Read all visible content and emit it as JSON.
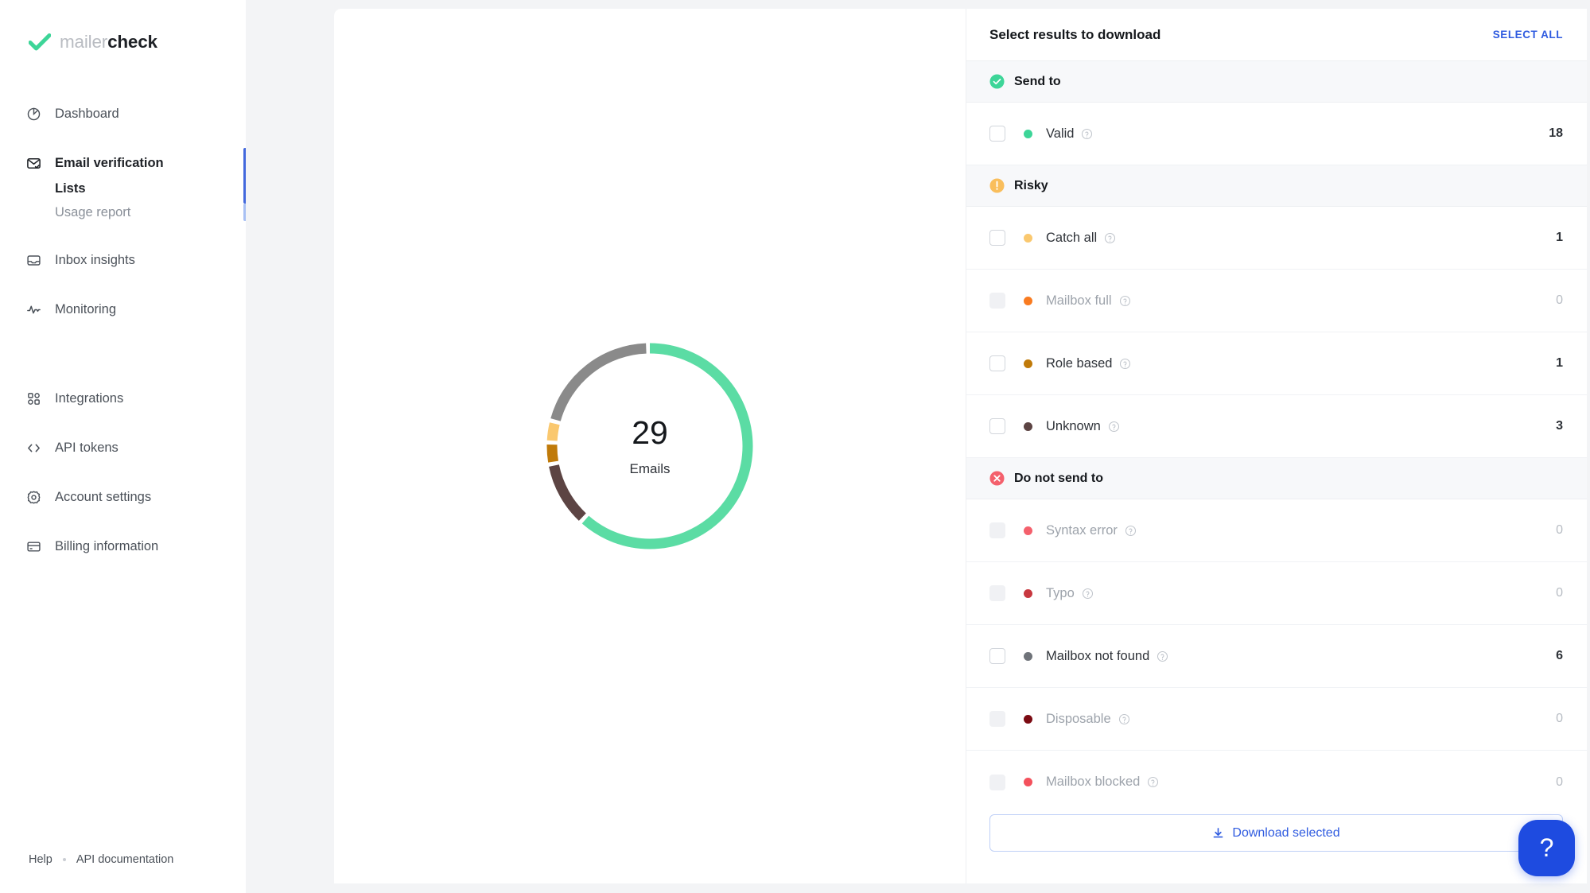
{
  "brand": {
    "name_light": "mailer",
    "name_bold": "check",
    "check_icon": "check-mark-icon",
    "green": "#3DD598"
  },
  "sidebar": {
    "items": [
      {
        "label": "Dashboard",
        "icon": "pie-chart-icon",
        "active": false
      },
      {
        "label": "Email verification",
        "icon": "envelope-check-icon",
        "active": true
      },
      {
        "label": "Inbox insights",
        "icon": "inbox-icon",
        "active": false
      },
      {
        "label": "Monitoring",
        "icon": "activity-pulse-icon",
        "active": false
      },
      {
        "label": "Integrations",
        "icon": "grid-squares-icon",
        "active": false
      },
      {
        "label": "API tokens",
        "icon": "code-brackets-icon",
        "active": false
      },
      {
        "label": "Account settings",
        "icon": "gear-icon",
        "active": false
      },
      {
        "label": "Billing information",
        "icon": "credit-card-icon",
        "active": false
      }
    ],
    "subnav": [
      {
        "label": "Lists",
        "active": true
      },
      {
        "label": "Usage report",
        "active": false
      }
    ],
    "footer": {
      "help": "Help",
      "api_documentation": "API documentation"
    },
    "active_accent": "#4268DD"
  },
  "chart_data": {
    "type": "pie",
    "title": "",
    "center_value": "29",
    "center_label": "Emails",
    "total": 29,
    "categories": [
      "Valid",
      "Unknown",
      "Role based",
      "Catch all",
      "Mailbox not found"
    ],
    "values": [
      18,
      3,
      1,
      1,
      6
    ],
    "colors": [
      "#5BDCA4",
      "#5C4443",
      "#C07A09",
      "#FAC86F",
      "#8A8A8A"
    ],
    "legend": "none",
    "donut": true
  },
  "results": {
    "title": "Select results to download",
    "select_all_label": "SELECT ALL",
    "groups": [
      {
        "name": "Send to",
        "badge_icon": "check-circle-icon",
        "badge_color": "#3DD598",
        "rows": [
          {
            "label": "Valid",
            "count": "18",
            "dot": "#3DD598",
            "disabled": false
          }
        ]
      },
      {
        "name": "Risky",
        "badge_icon": "exclamation-circle-icon",
        "badge_color": "#F9BE5C",
        "rows": [
          {
            "label": "Catch all",
            "count": "1",
            "dot": "#FAC86F",
            "disabled": false
          },
          {
            "label": "Mailbox full",
            "count": "0",
            "dot": "#F97B20",
            "disabled": true
          },
          {
            "label": "Role based",
            "count": "1",
            "dot": "#C07A09",
            "disabled": false
          },
          {
            "label": "Unknown",
            "count": "3",
            "dot": "#5C4443",
            "disabled": false
          }
        ]
      },
      {
        "name": "Do not send to",
        "badge_icon": "x-circle-icon",
        "badge_color": "#F4606C",
        "rows": [
          {
            "label": "Syntax error",
            "count": "0",
            "dot": "#F4606C",
            "disabled": true
          },
          {
            "label": "Typo",
            "count": "0",
            "dot": "#C8383F",
            "disabled": true
          },
          {
            "label": "Mailbox not found",
            "count": "6",
            "dot": "#6F7379",
            "disabled": false
          },
          {
            "label": "Disposable",
            "count": "0",
            "dot": "#7B0A12",
            "disabled": true
          },
          {
            "label": "Mailbox blocked",
            "count": "0",
            "dot": "#F4515C",
            "disabled": true
          }
        ]
      }
    ],
    "download_label": "Download selected",
    "download_icon": "download-icon",
    "row_help_icon": "question-circle-icon"
  },
  "help_fab": {
    "glyph": "?",
    "icon": "question-mark-icon",
    "color": "#1E4BE0"
  }
}
